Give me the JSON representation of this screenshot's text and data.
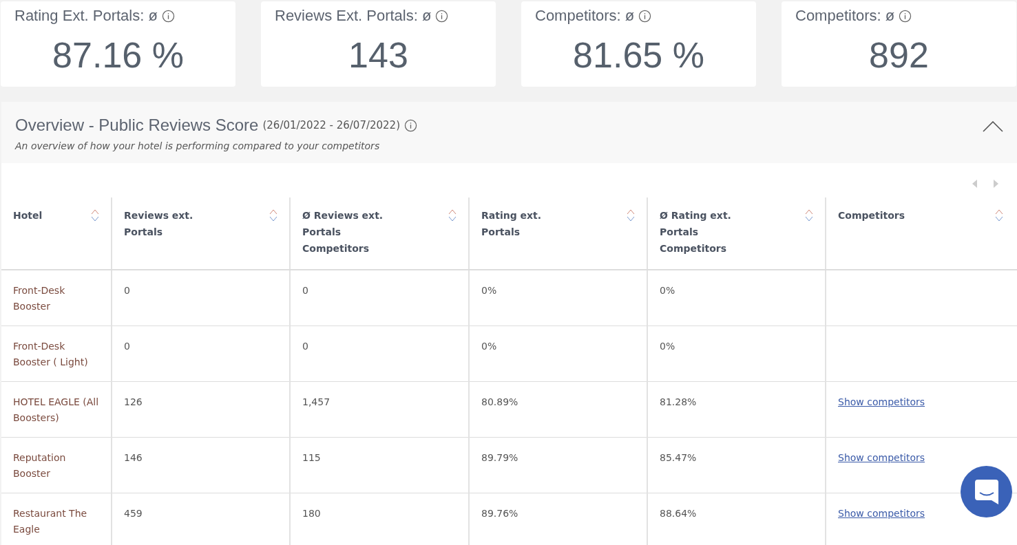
{
  "kpi_cards": [
    {
      "label": "Rating Ext. Portals: ø",
      "value": "87.16 %"
    },
    {
      "label": "Reviews Ext. Portals: ø",
      "value": "143"
    },
    {
      "label": "Competitors: ø",
      "value": "81.65 %"
    },
    {
      "label": "Competitors: ø",
      "value": "892"
    }
  ],
  "panel": {
    "title": "Overview - Public Reviews Score",
    "date_range": "(26/01/2022 - 26/07/2022)",
    "subtitle": "An overview of how your hotel is performing compared to your competitors",
    "expanded": true
  },
  "table": {
    "columns": [
      "Hotel",
      "Reviews ext. Portals",
      "Ø Reviews ext. Portals Competitors",
      "Rating ext. Portals",
      "Ø Rating ext. Portals Competitors",
      "Competitors"
    ],
    "rows": [
      {
        "hotel": "Front-Desk Booster",
        "reviews": "0",
        "avg_reviews": "0",
        "rating": "0%",
        "avg_rating": "0%"
      },
      {
        "hotel": "Front-Desk Booster ( Light)",
        "reviews": "0",
        "avg_reviews": "0",
        "rating": "0%",
        "avg_rating": "0%"
      },
      {
        "hotel": "HOTEL EAGLE (All Boosters)",
        "reviews": "126",
        "avg_reviews": "1,457",
        "rating": "80.89%",
        "avg_rating": "81.28%",
        "link": "Show competitors"
      },
      {
        "hotel": "Reputation Booster",
        "reviews": "146",
        "avg_reviews": "115",
        "rating": "89.79%",
        "avg_rating": "85.47%",
        "link": "Show competitors"
      },
      {
        "hotel": "Restaurant The Eagle",
        "reviews": "459",
        "avg_reviews": "180",
        "rating": "89.76%",
        "avg_rating": "88.64%",
        "link": "Show competitors"
      }
    ]
  }
}
